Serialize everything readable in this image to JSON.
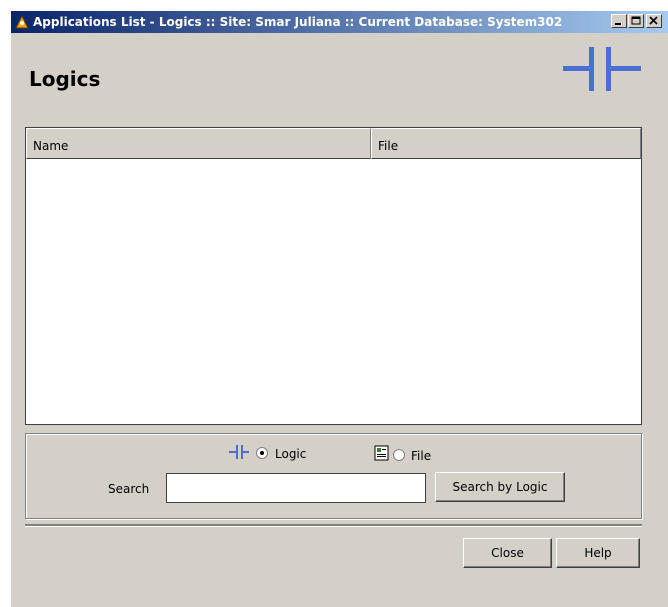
{
  "window": {
    "title": "Applications List - Logics :: Site: Smar Juliana :: Current Database: System302"
  },
  "page": {
    "title": "Logics"
  },
  "table": {
    "columns": [
      "Name",
      "File"
    ],
    "rows": []
  },
  "search_panel": {
    "mode_logic_label": "Logic",
    "mode_file_label": "File",
    "selected_mode": "Logic",
    "search_label": "Search",
    "search_value": "",
    "search_button_label": "Search by Logic"
  },
  "footer": {
    "close_label": "Close",
    "help_label": "Help"
  },
  "colors": {
    "logic_icon": "#4a6fd4",
    "titlebar_start": "#0a246a",
    "titlebar_end": "#a6caf0",
    "window_bg": "#d4d0c8"
  },
  "icons": {
    "app": "app-icon",
    "logic": "logic-icon",
    "file": "file-icon",
    "minimize": "minimize-icon",
    "maximize": "maximize-icon",
    "close": "close-icon"
  }
}
